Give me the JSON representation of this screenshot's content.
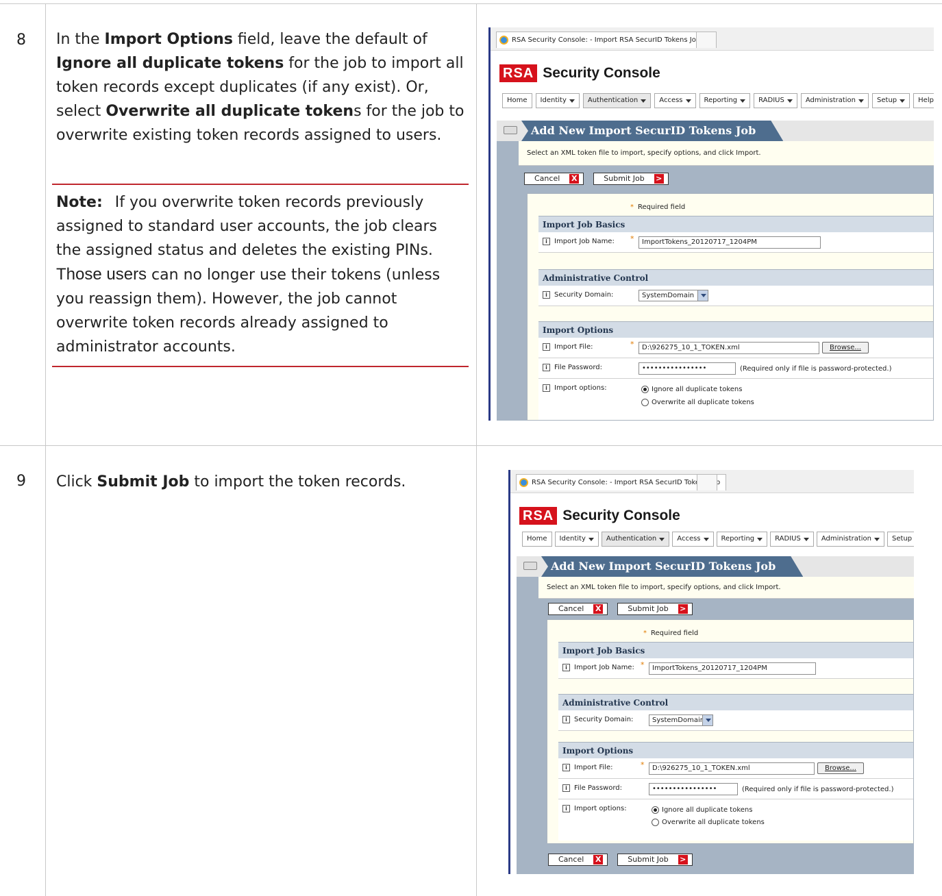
{
  "steps": [
    {
      "number": "8",
      "text_parts": {
        "p1": "In the ",
        "b1": "Import Options",
        "p2": " field, leave the default of ",
        "b2": "Ignore all duplicate tokens",
        "p3": " for the job to import all token records except duplicates (if any exist). Or, select ",
        "b3": "Overwrite all duplicate token",
        "p4": "s for the job to overwrite existing token records assigned to users."
      },
      "note": {
        "lead": "Note:",
        "t1": "If you overwrite token records previously assigned to standard user accounts, the job clears the assigned status and deletes the existing PINs.",
        "t2": "Those users",
        "t3": " can no longer use their tokens (unless you reassign them). However, the job cannot overwrite token records already assigned to administrator accounts."
      }
    },
    {
      "number": "9",
      "text_parts": {
        "p1": "Click ",
        "b1": "Submit Job",
        "p2": " to import the token records."
      }
    }
  ],
  "console": {
    "tab_title": "RSA Security Console: - Import RSA SecurID Tokens Job",
    "logo": "RSA",
    "app_title": "Security Console",
    "menu": [
      "Home",
      "Identity",
      "Authentication",
      "Access",
      "Reporting",
      "RADIUS",
      "Administration",
      "Setup",
      "Help"
    ],
    "page_title": "Add New Import SecurID Tokens Job",
    "instruction": "Select an XML token file to import, specify options, and click Import.",
    "cancel_label": "Cancel",
    "submit_label": "Submit Job",
    "required_note": "Required field",
    "sections": {
      "basics": "Import Job Basics",
      "admin": "Administrative Control",
      "options": "Import Options"
    },
    "fields": {
      "job_name_label": "Import Job Name:",
      "job_name_value": "ImportTokens_20120717_1204PM",
      "domain_label": "Security Domain:",
      "domain_value": "SystemDomain",
      "file_label": "Import File:",
      "file_value": "D:\\926275_10_1_TOKEN.xml",
      "browse_label": "Browse...",
      "password_label": "File Password:",
      "password_value": "••••••••••••••••",
      "password_hint": "(Required only if file is password-protected.)",
      "options_label": "Import options:",
      "option_ignore": "Ignore all duplicate tokens",
      "option_overwrite": "Overwrite all duplicate tokens"
    }
  }
}
